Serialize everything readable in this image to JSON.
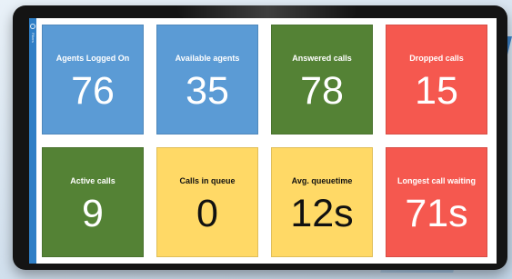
{
  "sidebar": {
    "icon": "info-icon",
    "label": "Filters"
  },
  "colors": {
    "blue": "#5b9bd5",
    "green": "#548235",
    "red": "#f5584f",
    "yellow": "#ffd966",
    "sidebar": "#2f7fc6"
  },
  "tiles": [
    {
      "label": "Agents Logged On",
      "value": "76"
    },
    {
      "label": "Available agents",
      "value": "35"
    },
    {
      "label": "Answered calls",
      "value": "78"
    },
    {
      "label": "Dropped calls",
      "value": "15"
    },
    {
      "label": "Active calls",
      "value": "9"
    },
    {
      "label": "Calls in queue",
      "value": "0"
    },
    {
      "label": "Avg. queuetime",
      "value": "12s"
    },
    {
      "label": "Longest call waiting",
      "value": "71s"
    }
  ]
}
